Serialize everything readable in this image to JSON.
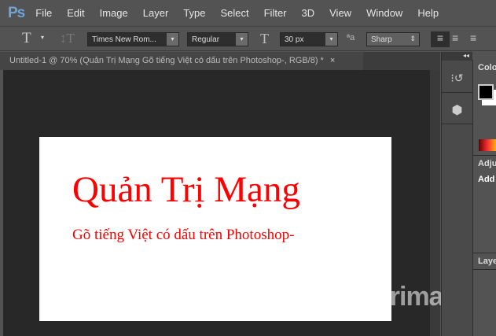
{
  "app": {
    "logo": "Ps"
  },
  "menu": [
    "File",
    "Edit",
    "Image",
    "Layer",
    "Type",
    "Select",
    "Filter",
    "3D",
    "View",
    "Window",
    "Help"
  ],
  "options": {
    "tool_icon": "T",
    "font_family": "Times New Rom...",
    "font_style": "Regular",
    "font_size": "30 px",
    "antialias": "Sharp"
  },
  "tab": {
    "title": "Untitled-1 @ 70% (Quản Trị Mạng  Gõ tiếng Việt có dấu trên Photoshop-, RGB/8) *",
    "close": "×"
  },
  "document": {
    "heading": "Quản Trị Mạng",
    "subtext": "Gõ tiếng Việt có dấu trên Photoshop-",
    "text_color": "#ff0000"
  },
  "watermark": "uantrimang",
  "panels": {
    "color": "Colo",
    "adjustments": "Adju",
    "add": "Add",
    "layers": "Laye",
    "collapse": "◂◂"
  }
}
